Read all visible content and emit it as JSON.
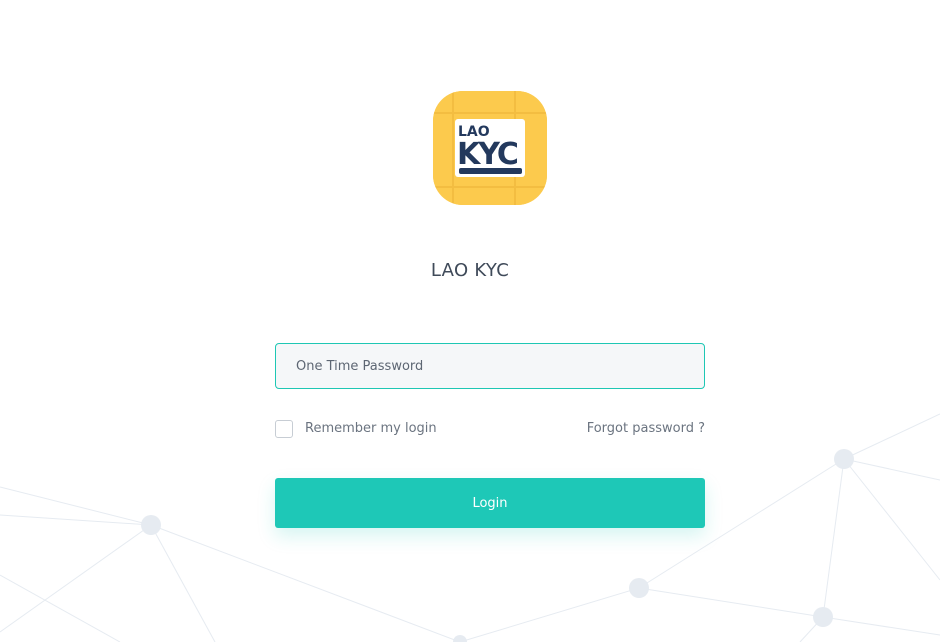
{
  "brand": {
    "logo_line1": "LAO",
    "logo_line2": "KYC",
    "app_title": "LAO KYC"
  },
  "form": {
    "otp_placeholder": "One Time Password",
    "otp_value": "",
    "remember_label": "Remember my login",
    "remember_checked": false,
    "forgot_label": "Forgot password ?",
    "login_label": "Login"
  },
  "colors": {
    "accent": "#1ec8b7",
    "logo_background": "#fcca4d",
    "title_text": "#3f4a59",
    "muted_text": "#6b7480"
  },
  "icons": {
    "logo": "lao-kyc-logo",
    "checkbox": "checkbox-unchecked-icon"
  }
}
